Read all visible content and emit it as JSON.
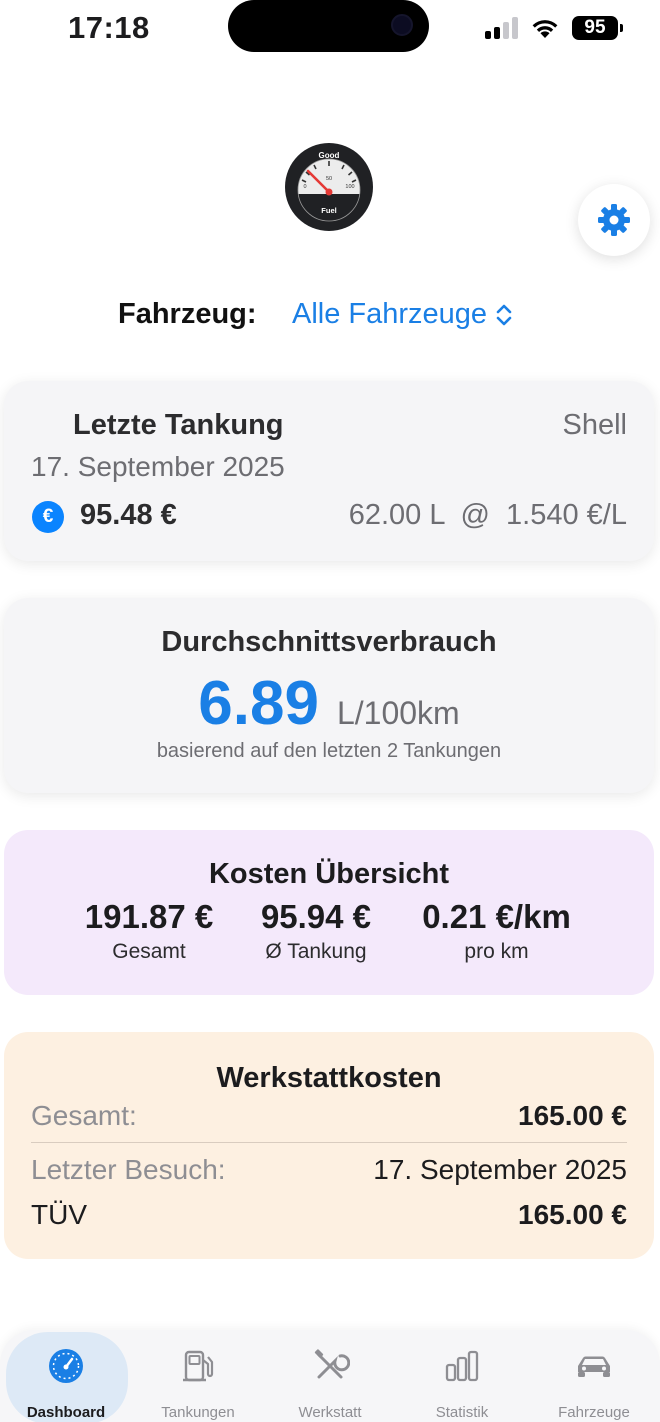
{
  "status_bar": {
    "time": "17:18",
    "battery": "95"
  },
  "logo": {
    "top_text": "Good",
    "scale_min": "0",
    "scale_mid": "50",
    "scale_max": "100",
    "bottom_text": "Fuel"
  },
  "vehicle": {
    "label": "Fahrzeug:",
    "selected": "Alle Fahrzeuge"
  },
  "last_refuel": {
    "title": "Letzte Tankung",
    "station": "Shell",
    "date": "17. September 2025",
    "currency_symbol": "€",
    "price": "95.48 €",
    "detail": "62.00 L  @  1.540 €/L"
  },
  "consumption": {
    "title": "Durchschnittsverbrauch",
    "value": "6.89",
    "unit": "L/100km",
    "note": "basierend auf den letzten 2 Tankungen"
  },
  "costs": {
    "title": "Kosten Übersicht",
    "stats": [
      {
        "value": "191.87 €",
        "label": "Gesamt"
      },
      {
        "value": "95.94 €",
        "label": "Ø Tankung"
      },
      {
        "value": "0.21 €/km",
        "label": "pro km"
      }
    ]
  },
  "workshop": {
    "title": "Werkstattkosten",
    "rows": [
      {
        "key": "Gesamt:",
        "value": "165.00 €"
      },
      {
        "key": "Letzter Besuch:",
        "value": "17. September 2025"
      },
      {
        "key": "TÜV",
        "value": "165.00 €"
      }
    ]
  },
  "tabs": [
    {
      "label": "Dashboard",
      "icon": "dashboard-gauge-icon",
      "active": true
    },
    {
      "label": "Tankungen",
      "icon": "fuel-pump-icon",
      "active": false
    },
    {
      "label": "Werkstatt",
      "icon": "wrench-screwdriver-icon",
      "active": false
    },
    {
      "label": "Statistik",
      "icon": "bar-chart-icon",
      "active": false
    },
    {
      "label": "Fahrzeuge",
      "icon": "car-icon",
      "active": false
    }
  ],
  "colors": {
    "accent": "#1a7fe5",
    "costs_bg": "#f4e9fb",
    "workshop_bg": "#fdf0e1",
    "active_tab_bg": "#dde9f6"
  }
}
